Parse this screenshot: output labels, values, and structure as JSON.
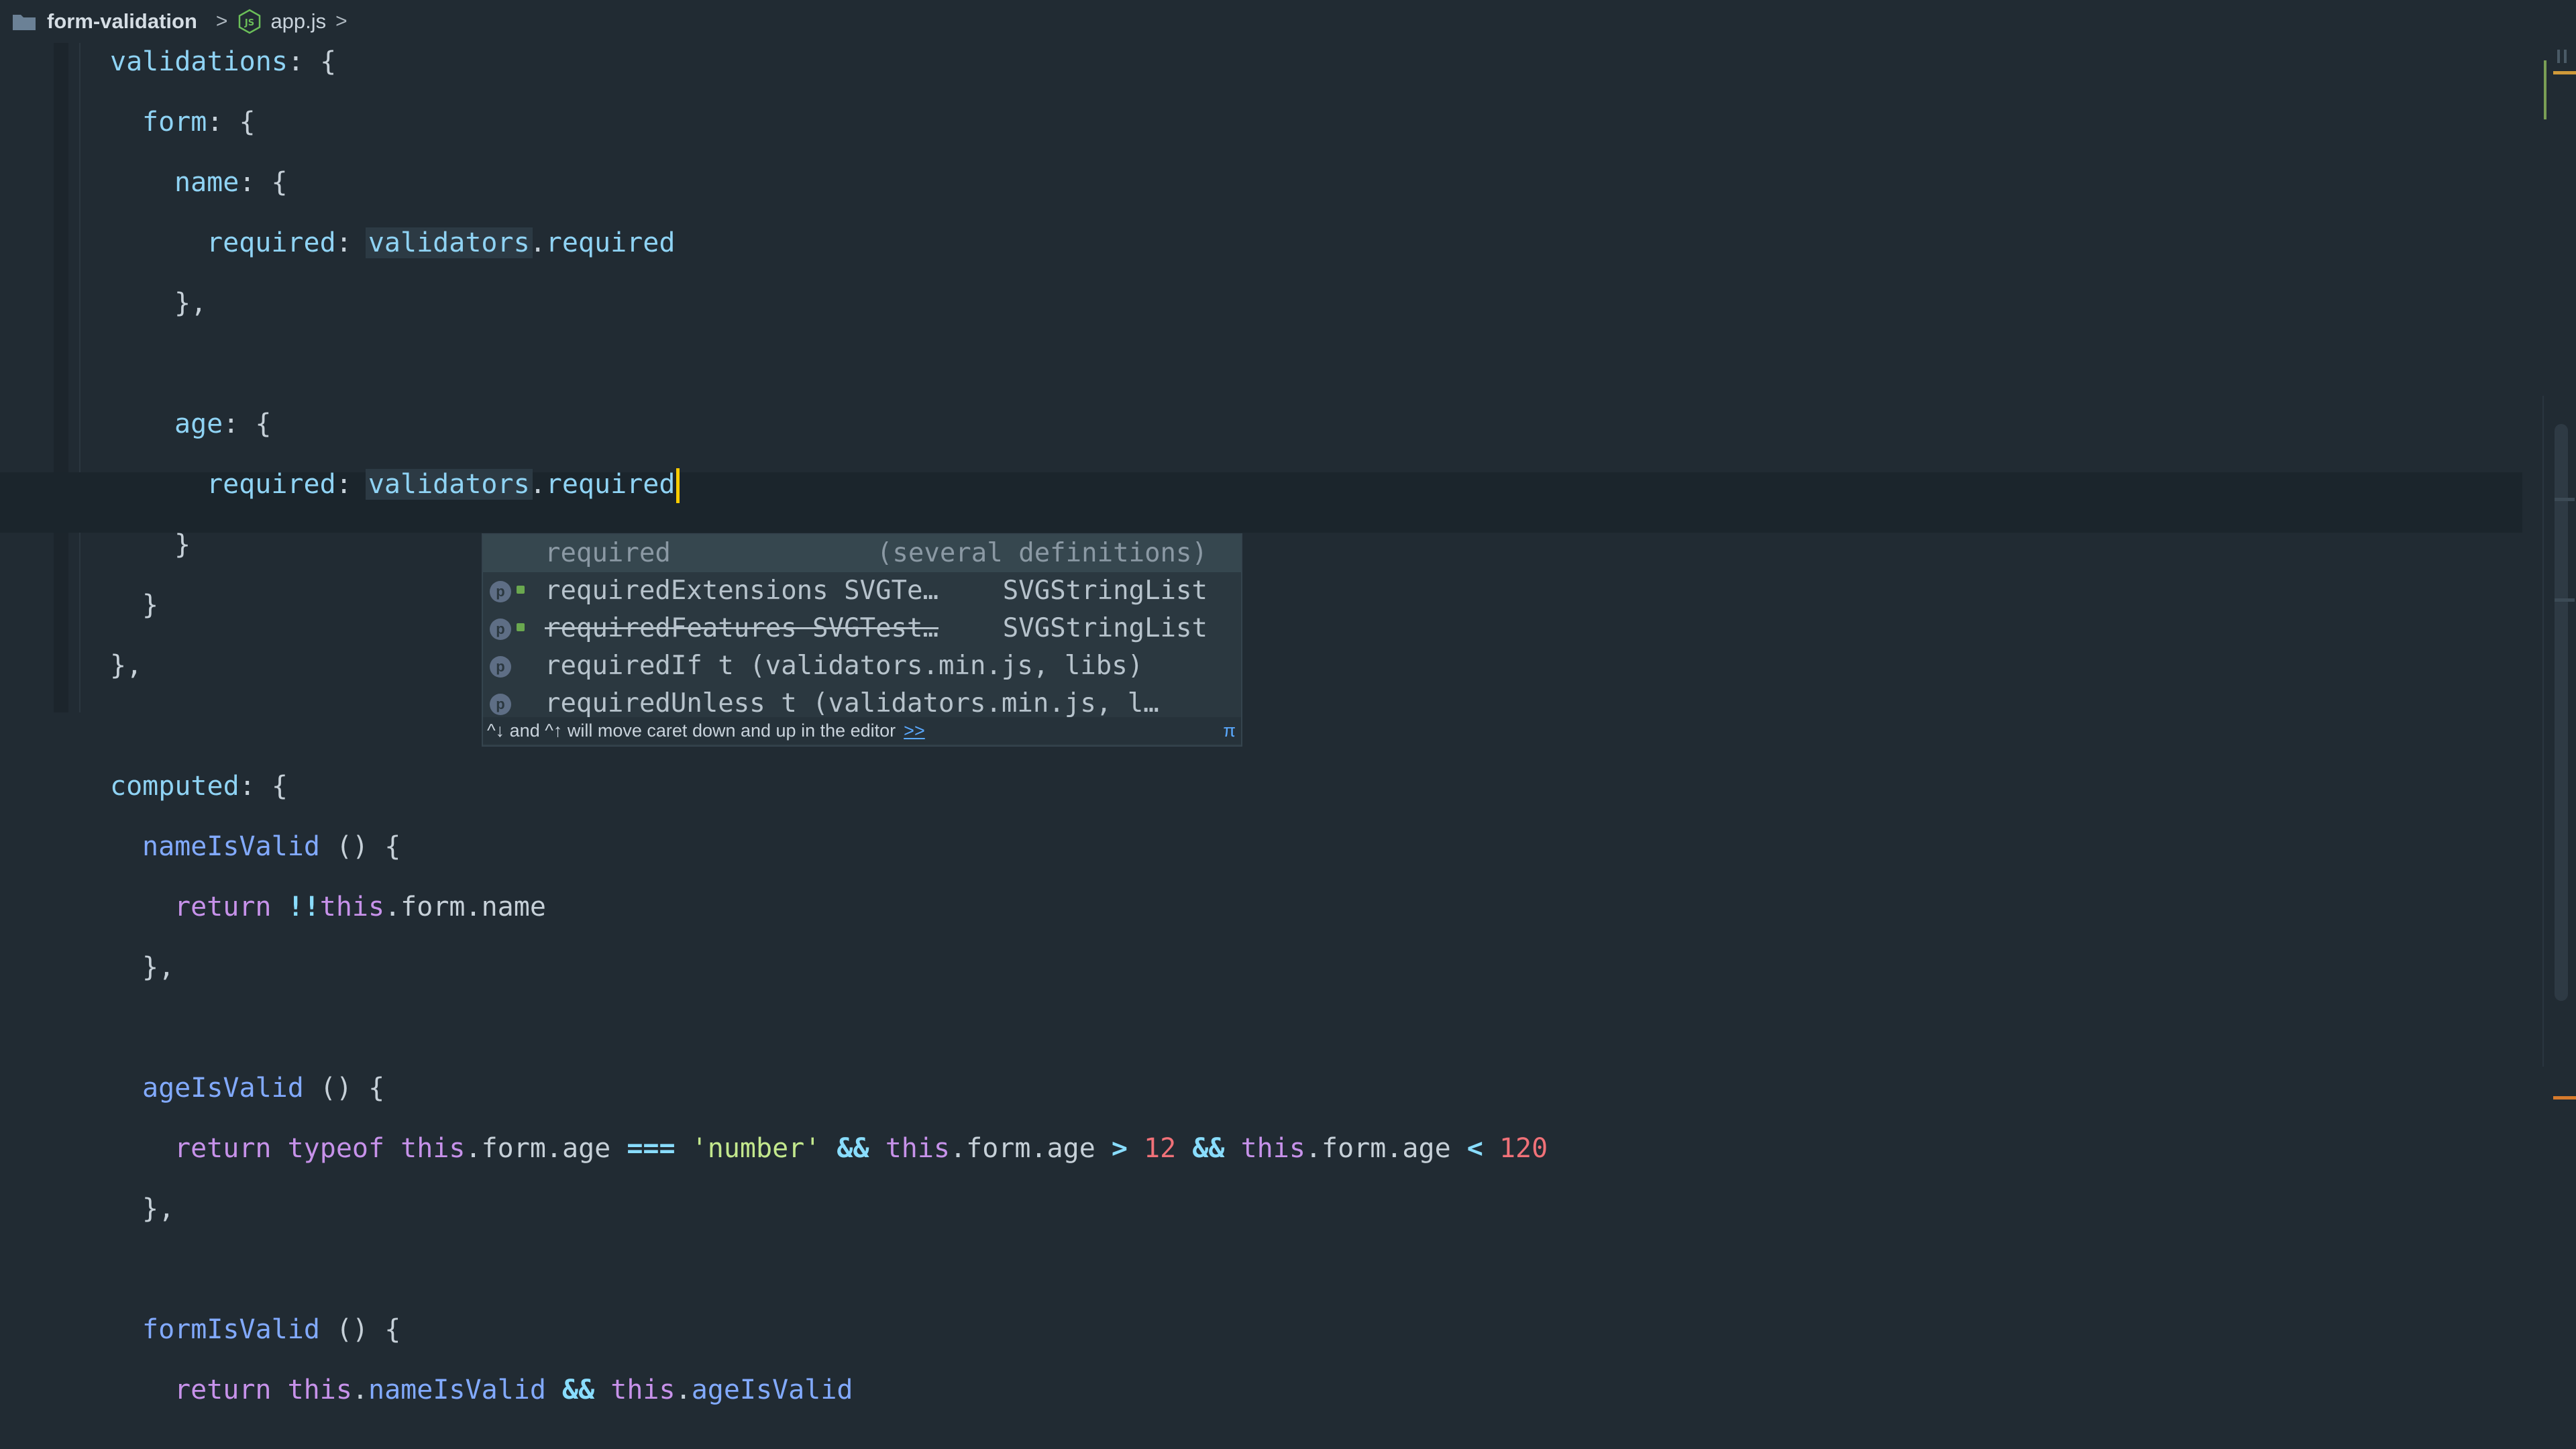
{
  "breadcrumb": {
    "folder": "form-validation",
    "file": "app.js",
    "separator": ">"
  },
  "autocomplete": {
    "items": [
      {
        "name": "required",
        "type": "(several definitions)",
        "selected": true,
        "deprecated": false,
        "icon": "none"
      },
      {
        "name": "requiredExtensions SVGTe…",
        "type": "SVGStringList",
        "selected": false,
        "deprecated": false,
        "icon": "property-icon"
      },
      {
        "name": "requiredFeatures SVGTest…",
        "type": "SVGStringList",
        "selected": false,
        "deprecated": true,
        "icon": "property-icon"
      },
      {
        "name": "requiredIf t (validators.min.js, libs)",
        "type": "",
        "selected": false,
        "deprecated": false,
        "icon": "property-icon"
      },
      {
        "name": "requiredUnless t (validators.min.js, l…",
        "type": "",
        "selected": false,
        "deprecated": false,
        "icon": "property-icon"
      }
    ],
    "icon_letter": "p",
    "footer": "^↓ and ^↑ will move caret down and up in the editor",
    "footer_link": ">>",
    "footer_pi": "π"
  },
  "colors": {
    "background": "#212b33",
    "caret": "#ffcc00",
    "keyword": "#c792ea",
    "function": "#82aaff",
    "string": "#c3e88d",
    "number": "#f07178"
  }
}
